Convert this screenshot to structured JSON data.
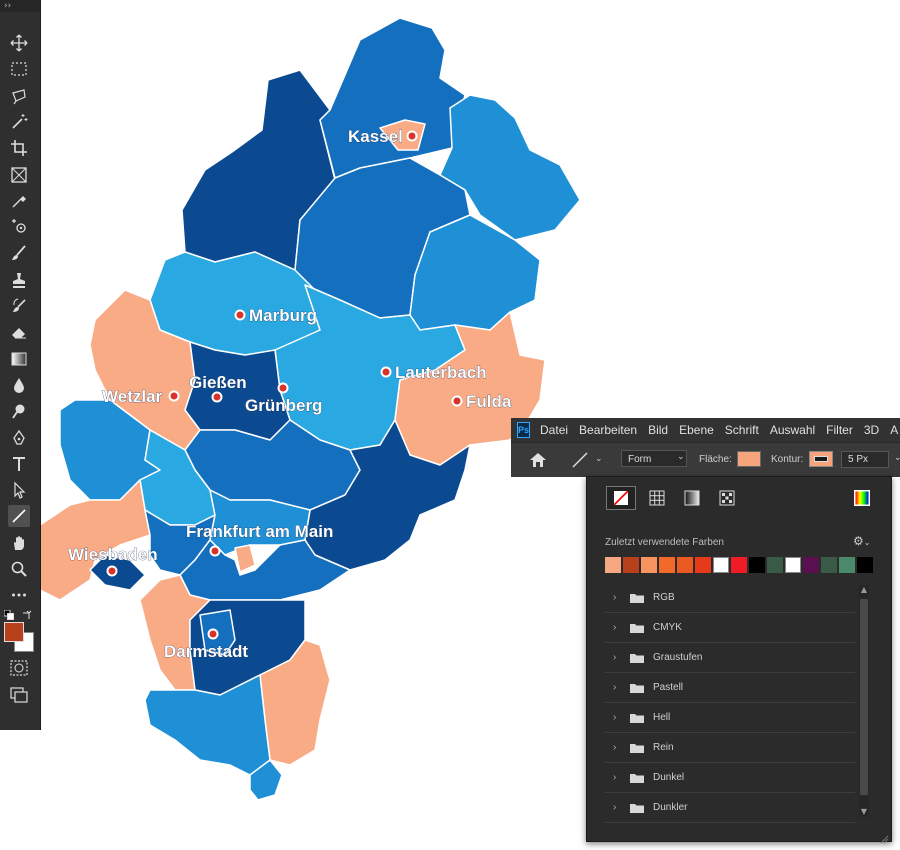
{
  "cities": [
    {
      "id": "kassel",
      "name": "Kassel"
    },
    {
      "id": "marburg",
      "name": "Marburg"
    },
    {
      "id": "giessen",
      "name": "Gießen"
    },
    {
      "id": "wetzlar",
      "name": "Wetzlar"
    },
    {
      "id": "gruenberg",
      "name": "Grünberg"
    },
    {
      "id": "lauterbach",
      "name": "Lauterbach"
    },
    {
      "id": "fulda",
      "name": "Fulda"
    },
    {
      "id": "frankfurt",
      "name": "Frankfurt am Main"
    },
    {
      "id": "wiesbaden",
      "name": "Wiesbaden"
    },
    {
      "id": "darmstadt",
      "name": "Darmstadt"
    }
  ],
  "colors": {
    "darkblue": "#0b4a91",
    "midblue": "#146fbe",
    "blue": "#1f8fd6",
    "lightblue": "#2aa8e2",
    "peach": "#f8ab85"
  },
  "toolbar": {
    "grip": "››",
    "tools": [
      "move-icon",
      "marquee-icon",
      "lasso-icon",
      "magic-wand-icon",
      "crop-icon",
      "frame-icon",
      "eyedropper-icon",
      "healing-icon",
      "brush-icon",
      "stamp-icon",
      "history-brush-icon",
      "eraser-icon",
      "gradient-icon",
      "blur-icon",
      "dodge-icon",
      "pen-icon",
      "type-icon",
      "path-select-icon",
      "line-icon",
      "hand-icon",
      "zoom-icon",
      "more-icon"
    ],
    "active_tool": "line-icon",
    "foreground_color": "#b8401a",
    "background_color": "#ffffff"
  },
  "app": {
    "logo": "Ps"
  },
  "menu": {
    "items": [
      "Datei",
      "Bearbeiten",
      "Bild",
      "Ebene",
      "Schrift",
      "Auswahl",
      "Filter",
      "3D",
      "A"
    ]
  },
  "options": {
    "mode_select": "Form",
    "fill_label": "Fläche:",
    "fill_color": "#f5a47b",
    "stroke_label": "Kontur:",
    "stroke_width": "5 Px"
  },
  "swatch_panel": {
    "recent_label": "Zuletzt verwendete Farben",
    "recent_colors": [
      "#f7a882",
      "#b8401a",
      "#f79460",
      "#f26a2a",
      "#ea5a20",
      "#e63a1a",
      "#ffffff",
      "#ee1c24",
      "#000000",
      "#3a5a48",
      "#ffffff",
      "#5a1050",
      "#3a5a48",
      "#4a8a6a",
      "#000000"
    ],
    "folders": [
      "RGB",
      "CMYK",
      "Graustufen",
      "Pastell",
      "Hell",
      "Rein",
      "Dunkel",
      "Dunkler"
    ]
  }
}
